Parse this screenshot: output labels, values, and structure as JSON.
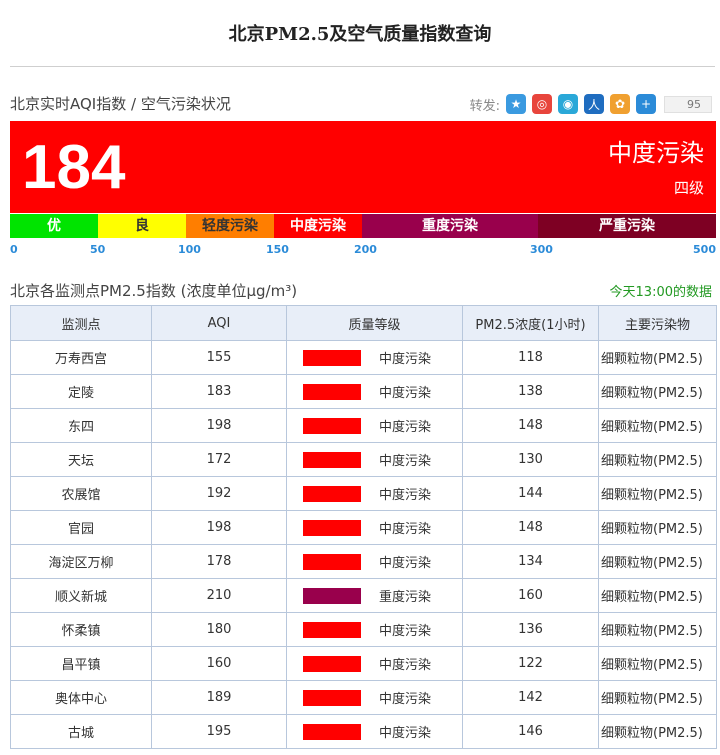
{
  "page": {
    "title": "北京PM2.5及空气质量指数查询"
  },
  "realtime": {
    "heading": "北京实时AQI指数 / 空气污染状况",
    "aqi": "184",
    "level": "中度污染",
    "grade": "四级",
    "color": "#ff0000"
  },
  "share": {
    "label": "转发:",
    "count": "95",
    "icons": [
      {
        "name": "qzone-icon",
        "glyph": "★",
        "color": "#3a9ae0"
      },
      {
        "name": "weibo-icon",
        "glyph": "◎",
        "color": "#e8453c"
      },
      {
        "name": "tencent-weibo-icon",
        "glyph": "◉",
        "color": "#2aa8d8"
      },
      {
        "name": "renren-icon",
        "glyph": "人",
        "color": "#1f6dc0"
      },
      {
        "name": "pengyou-icon",
        "glyph": "✿",
        "color": "#f0a030"
      },
      {
        "name": "more-share-icon",
        "glyph": "+",
        "color": "#2b8bd8"
      }
    ]
  },
  "scale": {
    "segments": [
      {
        "label": "优",
        "color": "#00e400",
        "text_color": "#ffffff",
        "from": 0,
        "to": 50
      },
      {
        "label": "良",
        "color": "#ffff00",
        "text_color": "#333333",
        "from": 50,
        "to": 100
      },
      {
        "label": "轻度污染",
        "color": "#ff7e00",
        "text_color": "#333333",
        "from": 100,
        "to": 150
      },
      {
        "label": "中度污染",
        "color": "#ff0000",
        "text_color": "#ffffff",
        "from": 150,
        "to": 200
      },
      {
        "label": "重度污染",
        "color": "#99004c",
        "text_color": "#ffffff",
        "from": 200,
        "to": 300
      },
      {
        "label": "严重污染",
        "color": "#7e0023",
        "text_color": "#ffffff",
        "from": 300,
        "to": 500
      }
    ],
    "ticks": [
      "0",
      "50",
      "100",
      "150",
      "200",
      "300",
      "500"
    ],
    "tick_values": [
      0,
      50,
      100,
      150,
      200,
      300,
      500
    ]
  },
  "stations": {
    "heading": "北京各监测点PM2.5指数 (浓度单位μg/m³)",
    "update_text": "今天13:00的数据",
    "columns": [
      "监测点",
      "AQI",
      "质量等级",
      "PM2.5浓度(1小时)",
      "主要污染物"
    ],
    "rows": [
      {
        "name": "万寿西宫",
        "aqi": "155",
        "level": "中度污染",
        "color": "#ff0000",
        "pm25": "118",
        "pollutant": "细颗粒物(PM2.5)"
      },
      {
        "name": "定陵",
        "aqi": "183",
        "level": "中度污染",
        "color": "#ff0000",
        "pm25": "138",
        "pollutant": "细颗粒物(PM2.5)"
      },
      {
        "name": "东四",
        "aqi": "198",
        "level": "中度污染",
        "color": "#ff0000",
        "pm25": "148",
        "pollutant": "细颗粒物(PM2.5)"
      },
      {
        "name": "天坛",
        "aqi": "172",
        "level": "中度污染",
        "color": "#ff0000",
        "pm25": "130",
        "pollutant": "细颗粒物(PM2.5)"
      },
      {
        "name": "农展馆",
        "aqi": "192",
        "level": "中度污染",
        "color": "#ff0000",
        "pm25": "144",
        "pollutant": "细颗粒物(PM2.5)"
      },
      {
        "name": "官园",
        "aqi": "198",
        "level": "中度污染",
        "color": "#ff0000",
        "pm25": "148",
        "pollutant": "细颗粒物(PM2.5)"
      },
      {
        "name": "海淀区万柳",
        "aqi": "178",
        "level": "中度污染",
        "color": "#ff0000",
        "pm25": "134",
        "pollutant": "细颗粒物(PM2.5)"
      },
      {
        "name": "顺义新城",
        "aqi": "210",
        "level": "重度污染",
        "color": "#99004c",
        "pm25": "160",
        "pollutant": "细颗粒物(PM2.5)"
      },
      {
        "name": "怀柔镇",
        "aqi": "180",
        "level": "中度污染",
        "color": "#ff0000",
        "pm25": "136",
        "pollutant": "细颗粒物(PM2.5)"
      },
      {
        "name": "昌平镇",
        "aqi": "160",
        "level": "中度污染",
        "color": "#ff0000",
        "pm25": "122",
        "pollutant": "细颗粒物(PM2.5)"
      },
      {
        "name": "奥体中心",
        "aqi": "189",
        "level": "中度污染",
        "color": "#ff0000",
        "pm25": "142",
        "pollutant": "细颗粒物(PM2.5)"
      },
      {
        "name": "古城",
        "aqi": "195",
        "level": "中度污染",
        "color": "#ff0000",
        "pm25": "146",
        "pollutant": "细颗粒物(PM2.5)"
      }
    ]
  }
}
